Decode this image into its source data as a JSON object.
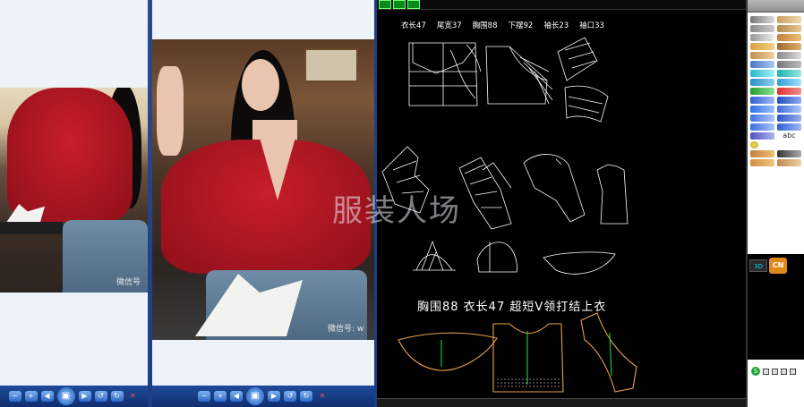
{
  "viewer_left": {
    "watermark": "微信号"
  },
  "viewer_mid": {
    "watermark": "微信号: w"
  },
  "viewer_toolbar": {
    "buttons": [
      "zoom-out",
      "zoom-in",
      "previous",
      "actual-size",
      "next",
      "rotate-left",
      "rotate-right",
      "close"
    ],
    "close_glyph": "✕"
  },
  "cad": {
    "measurements": [
      "衣长47",
      "尾宽37",
      "胸围88",
      "下摆92",
      "袖长23",
      "袖口33"
    ],
    "title": "胸围88   衣长47   超短V领打结上衣",
    "watermark": "服装人场"
  },
  "palette": {
    "label_3d": "3D",
    "label_cn": "CN",
    "label_abc": "abc",
    "label_s": "S"
  },
  "colors": {
    "cad_bg": "#000000",
    "pattern_line": "#ffffff",
    "pattern_orange": "#e8a048",
    "grain_green": "#20c040",
    "viewer_bar": "#1c3e85"
  }
}
